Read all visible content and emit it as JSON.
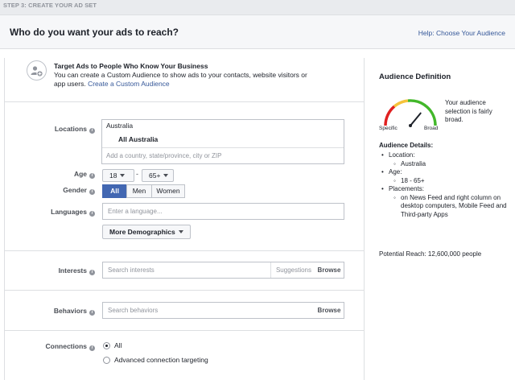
{
  "step_label": "STEP 3: CREATE YOUR AD SET",
  "header": {
    "title": "Who do you want your ads to reach?",
    "help_link": "Help: Choose Your Audience"
  },
  "custom_audience": {
    "title": "Target Ads to People Who Know Your Business",
    "description": "You can create a Custom Audience to show ads to your contacts, website visitors or app users.",
    "link": "Create a Custom Audience",
    "icon": "add-people-icon"
  },
  "locations": {
    "label": "Locations",
    "country": "Australia",
    "selected": "All Australia",
    "placeholder": "Add a country, state/province, city or ZIP"
  },
  "age": {
    "label": "Age",
    "min": "18",
    "dash": "-",
    "max": "65+"
  },
  "gender": {
    "label": "Gender",
    "options": [
      "All",
      "Men",
      "Women"
    ],
    "selected": "All"
  },
  "languages": {
    "label": "Languages",
    "placeholder": "Enter a language..."
  },
  "more_demographics": "More Demographics",
  "interests": {
    "label": "Interests",
    "placeholder": "Search interests",
    "suggestions": "Suggestions",
    "browse": "Browse"
  },
  "behaviors": {
    "label": "Behaviors",
    "placeholder": "Search behaviors",
    "browse": "Browse"
  },
  "connections": {
    "label": "Connections",
    "options": [
      "All",
      "Advanced connection targeting"
    ],
    "selected": "All"
  },
  "audience_definition": {
    "title": "Audience Definition",
    "gauge_specific": "Specific",
    "gauge_broad": "Broad",
    "gauge_level": 0.72,
    "summary": "Your audience selection is fairly broad.",
    "details_title": "Audience Details:",
    "location_label": "Location:",
    "location_value": "Australia",
    "age_label": "Age:",
    "age_value": "18 - 65+",
    "placements_label": "Placements:",
    "placements_value": "on News Feed and right column on desktop computers, Mobile Feed and Third-party Apps",
    "potential_reach": "Potential Reach: 12,600,000 people"
  },
  "colors": {
    "accent": "#4267b2",
    "link": "#365899",
    "gauge_red": "#e02020",
    "gauge_yellow": "#f5c33b",
    "gauge_green": "#42b72a"
  }
}
